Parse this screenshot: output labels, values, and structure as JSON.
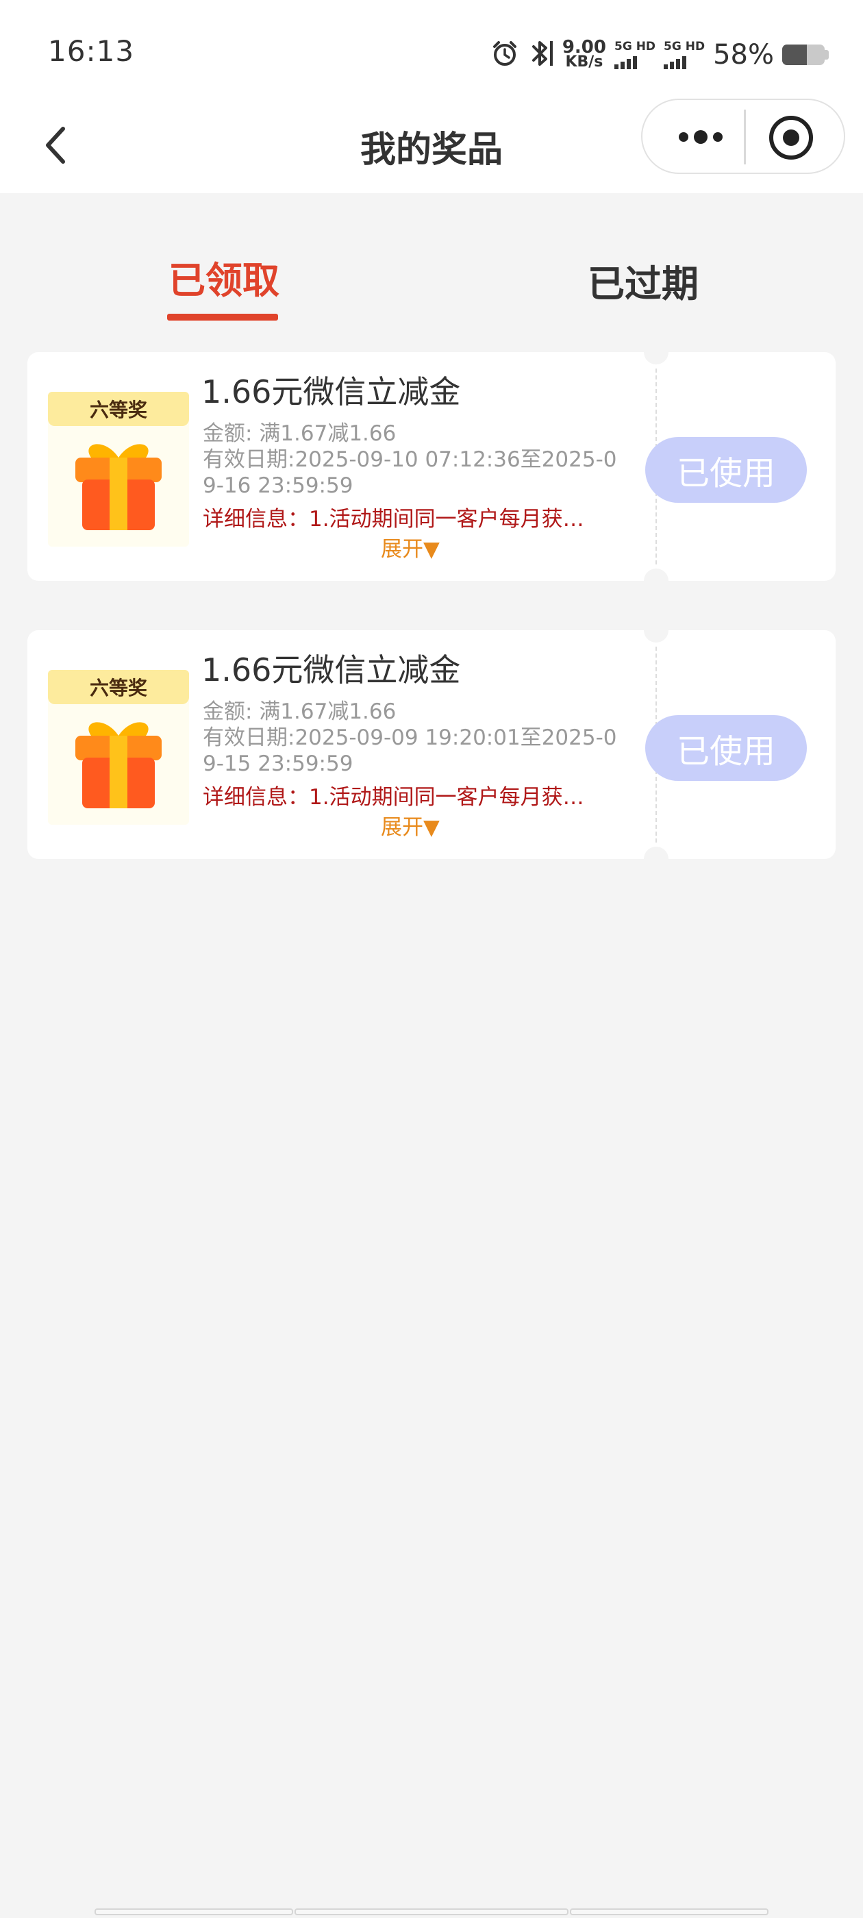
{
  "status_bar": {
    "time": "16:13",
    "net_speed_value": "9.00",
    "net_speed_unit": "KB/s",
    "sim1_label": "5G HD",
    "sim2_label": "5G HD",
    "battery_percent": "58%",
    "battery_level": 0.58
  },
  "nav": {
    "title": "我的奖品"
  },
  "tabs": [
    {
      "label": "已领取",
      "active": true
    },
    {
      "label": "已过期",
      "active": false
    }
  ],
  "prizes": [
    {
      "badge": "六等奖",
      "title": "1.66元微信立减金",
      "amount": "金额: 满1.67减1.66",
      "validity_line1": "有效日期:2025-09-10 07:12:36至2025-0",
      "validity_line2": "9-16 23:59:59",
      "detail": "详细信息：1.活动期间同一客户每月获…",
      "expand": "展开▼",
      "status": "已使用"
    },
    {
      "badge": "六等奖",
      "title": "1.66元微信立减金",
      "amount": "金额: 满1.67减1.66",
      "validity_line1": "有效日期:2025-09-09 19:20:01至2025-0",
      "validity_line2": "9-15 23:59:59",
      "detail": "详细信息：1.活动期间同一客户每月获…",
      "expand": "展开▼",
      "status": "已使用"
    }
  ],
  "colors": {
    "accent_red": "#e0432b",
    "used_button": "#c8cffa",
    "detail_text": "#b01818",
    "expand_text": "#e88a1c"
  },
  "icons": {
    "alarm": "alarm-icon",
    "bluetooth": "bluetooth-icon",
    "back": "back-arrow-icon",
    "more": "more-dots-icon",
    "close": "target-close-icon",
    "gift": "gift-box-icon"
  }
}
